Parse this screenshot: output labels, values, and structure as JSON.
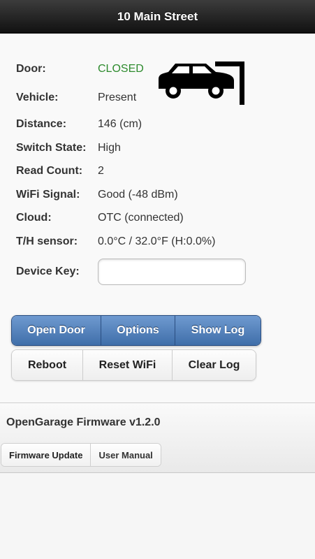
{
  "header": {
    "title": "10 Main Street"
  },
  "status": {
    "door": {
      "label": "Door:",
      "value": "CLOSED"
    },
    "vehicle": {
      "label": "Vehicle:",
      "value": "Present"
    },
    "distance": {
      "label": "Distance:",
      "value": "146 (cm)"
    },
    "switch": {
      "label": "Switch State:",
      "value": "High"
    },
    "readcount": {
      "label": "Read Count:",
      "value": "2"
    },
    "wifi": {
      "label": "WiFi Signal:",
      "value": "Good (-48 dBm)"
    },
    "cloud": {
      "label": "Cloud:",
      "value": "OTC (connected)"
    },
    "th": {
      "label": "T/H sensor:",
      "value": "0.0°C / 32.0°F (H:0.0%)"
    }
  },
  "device_key": {
    "label": "Device Key:",
    "value": "",
    "placeholder": ""
  },
  "buttons": {
    "open_door": "Open Door",
    "options": "Options",
    "show_log": "Show Log",
    "reboot": "Reboot",
    "reset_wifi": "Reset WiFi",
    "clear_log": "Clear Log"
  },
  "footer": {
    "title": "OpenGarage Firmware v1.2.0",
    "firmware_update": "Firmware Update",
    "user_manual": "User Manual"
  },
  "colors": {
    "door_closed": "#2e8b2e",
    "header_bg": "#1a1a1a",
    "primary_button": "#4a78b3"
  },
  "icons": {
    "garage_status": "car-in-garage-icon"
  }
}
